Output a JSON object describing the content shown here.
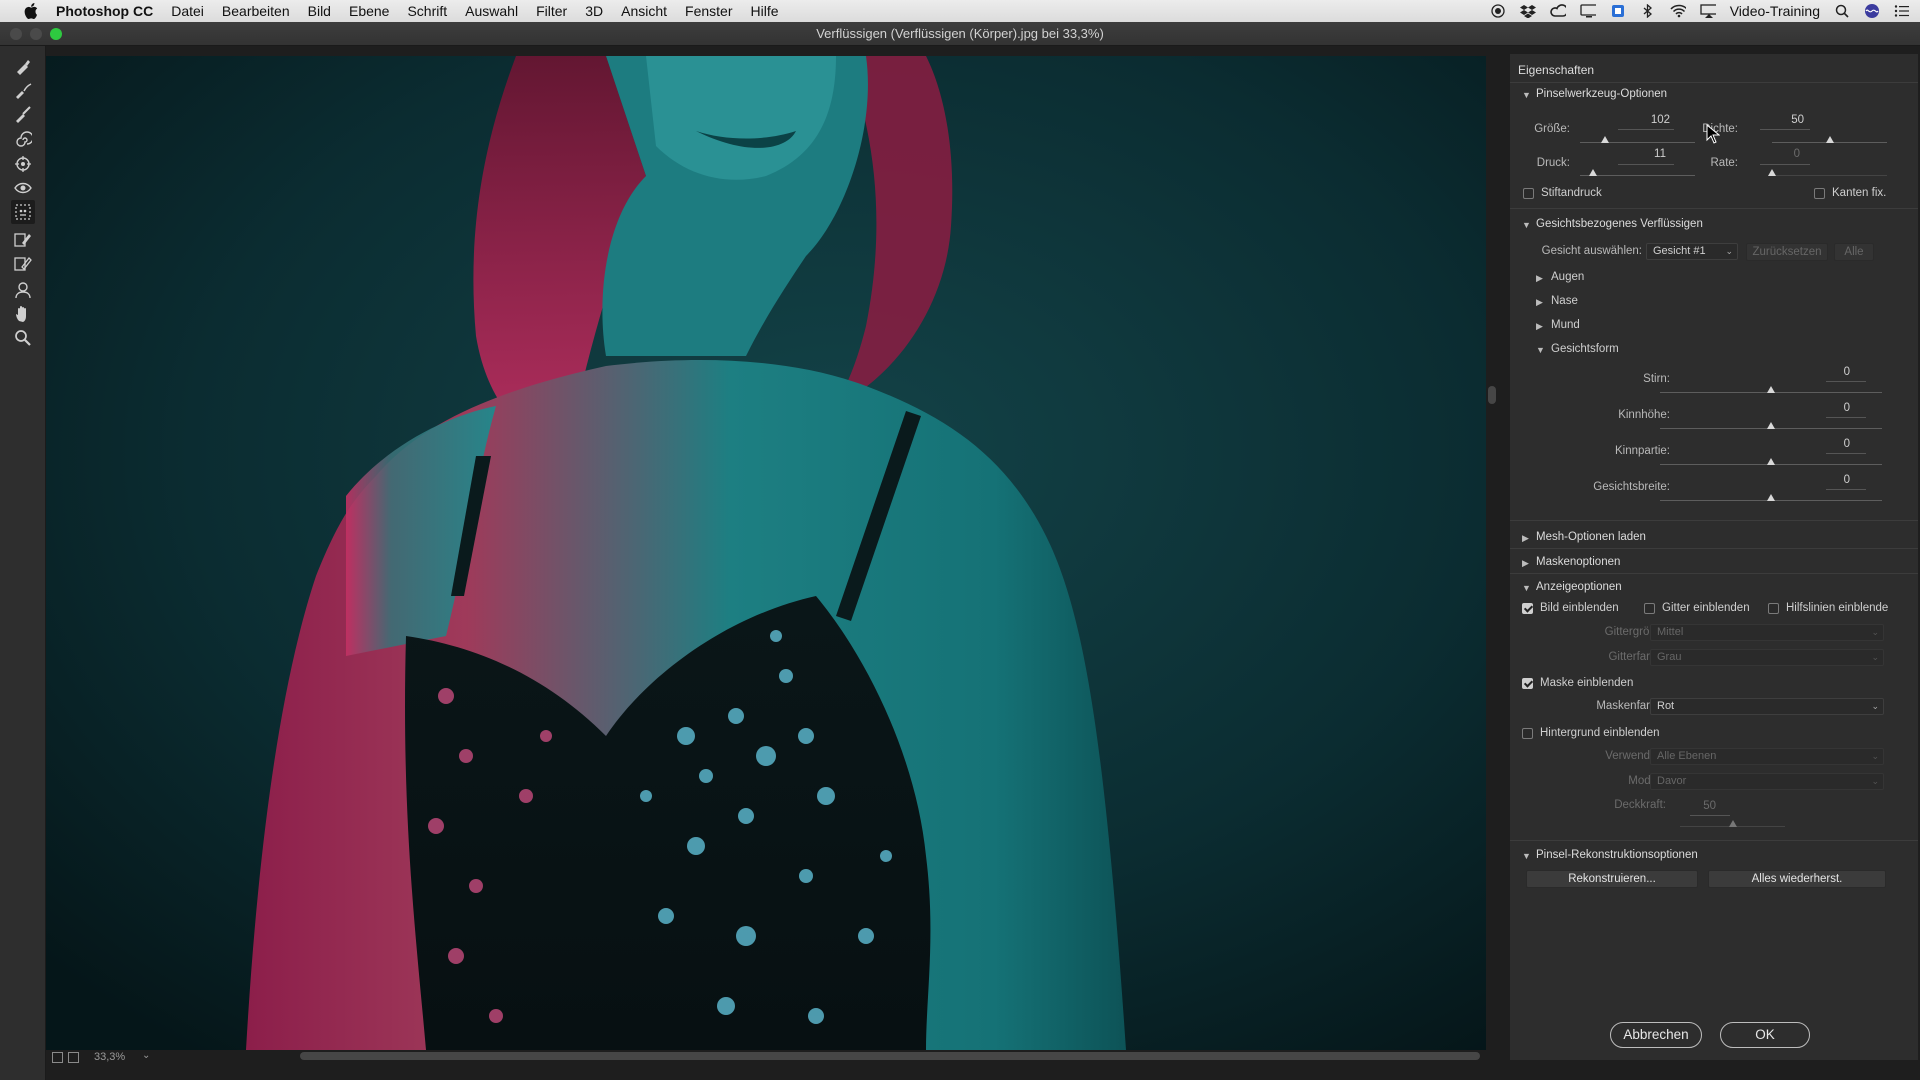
{
  "menubar": {
    "app": "Photoshop CC",
    "items": [
      "Datei",
      "Bearbeiten",
      "Bild",
      "Ebene",
      "Schrift",
      "Auswahl",
      "Filter",
      "3D",
      "Ansicht",
      "Fenster",
      "Hilfe"
    ],
    "user": "Video-Training"
  },
  "window": {
    "title": "Verflüssigen (Verflüssigen (Körper).jpg bei 33,3%)"
  },
  "statusbar": {
    "zoom": "33,3%"
  },
  "panel": {
    "title": "Eigenschaften",
    "brush": {
      "header": "Pinselwerkzeug-Optionen",
      "size_label": "Größe:",
      "size_value": "102",
      "size_level": 0.22,
      "density_label": "Dichte:",
      "density_value": "50",
      "density_level": 0.5,
      "pressure_label": "Druck:",
      "pressure_value": "11",
      "pressure_level": 0.11,
      "rate_label": "Rate:",
      "rate_value": "0",
      "rate_level": 0.0,
      "stylus_label": "Stiftandruck",
      "stylus_checked": false,
      "pin_edges_label": "Kanten fix.",
      "pin_edges_checked": false
    },
    "face": {
      "header": "Gesichtsbezogenes Verflüssigen",
      "select_label": "Gesicht auswählen:",
      "select_value": "Gesicht #1",
      "reset_label": "Zurücksetzen",
      "all_label": "Alle",
      "eyes": "Augen",
      "nose": "Nase",
      "mouth": "Mund",
      "shape": "Gesichtsform",
      "sliders": [
        {
          "label": "Stirn:",
          "value": "0"
        },
        {
          "label": "Kinnhöhe:",
          "value": "0"
        },
        {
          "label": "Kinnpartie:",
          "value": "0"
        },
        {
          "label": "Gesichtsbreite:",
          "value": "0"
        }
      ]
    },
    "mesh": {
      "header": "Mesh-Optionen laden"
    },
    "mask": {
      "header": "Maskenoptionen"
    },
    "view": {
      "header": "Anzeigeoptionen",
      "show_image": "Bild einblenden",
      "show_image_checked": true,
      "show_mesh": "Gitter einblenden",
      "show_mesh_checked": false,
      "show_guides": "Hilfslinien einblende",
      "show_guides_checked": false,
      "mesh_size_label": "Gittergröße:",
      "mesh_size_value": "Mittel",
      "mesh_color_label": "Gitterfarbe:",
      "mesh_color_value": "Grau",
      "show_mask": "Maske einblenden",
      "show_mask_checked": true,
      "mask_color_label": "Maskenfarbe:",
      "mask_color_value": "Rot",
      "show_backdrop": "Hintergrund einblenden",
      "show_backdrop_checked": false,
      "use_label": "Verwenden:",
      "use_value": "Alle Ebenen",
      "mode_label": "Modus:",
      "mode_value": "Davor",
      "opacity_label": "Deckkraft:",
      "opacity_value": "50",
      "opacity_level": 0.5
    },
    "reconstruct": {
      "header": "Pinsel-Rekonstruktionsoptionen",
      "reconstruct_btn": "Rekonstruieren...",
      "restore_all_btn": "Alles wiederherst."
    },
    "cancel": "Abbrechen",
    "ok": "OK"
  },
  "colors": {
    "accent_magenta": "#c8285a",
    "teal": "#1f8a8c",
    "background": "#0b2a2e"
  }
}
